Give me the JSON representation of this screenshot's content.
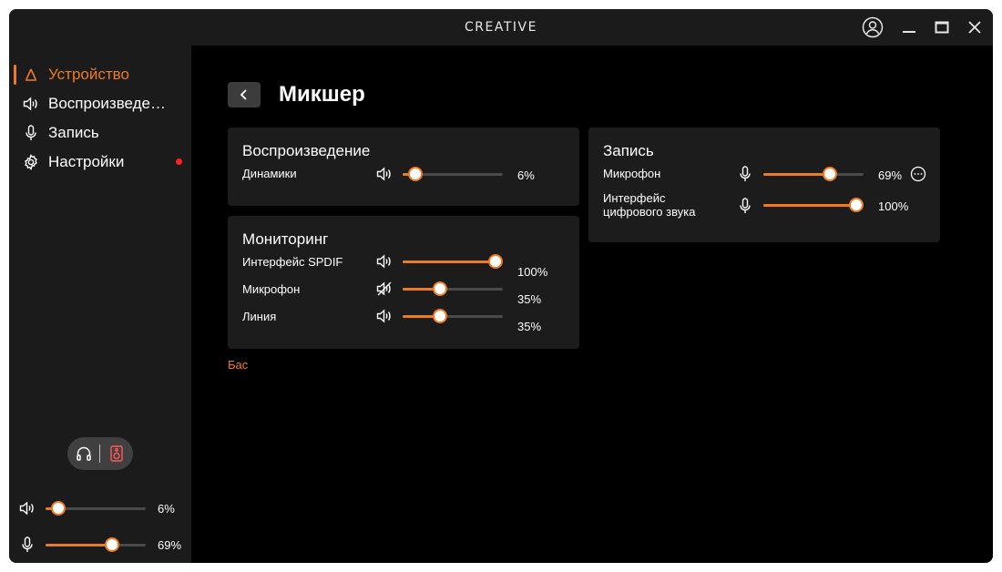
{
  "app": {
    "logo": "CREATIVE"
  },
  "window_controls": {
    "account": "user-icon",
    "minimize": "minimize-icon",
    "maximize": "maximize-icon",
    "close": "close-icon"
  },
  "sidebar": {
    "items": [
      {
        "label": "Устройство",
        "icon": "device-icon",
        "active": true
      },
      {
        "label": "Воспроизведение",
        "icon": "speaker-icon"
      },
      {
        "label": "Запись",
        "icon": "microphone-icon"
      },
      {
        "label": "Настройки",
        "icon": "gear-icon",
        "badge": "red-dot"
      }
    ],
    "output_toggle": {
      "left": "headphones-icon",
      "right": "speaker-box-icon"
    },
    "volume": {
      "icon": "speaker-icon",
      "value": 6,
      "text": "6%"
    },
    "mic": {
      "icon": "microphone-icon",
      "value": 69,
      "text": "69%"
    }
  },
  "page": {
    "title": "Микшер",
    "back_icon": "chevron-left-icon"
  },
  "playback_card": {
    "title": "Воспроизведение",
    "rows": [
      {
        "label": "Динамики",
        "icon": "speaker-icon",
        "value": 6,
        "text": "6%"
      }
    ]
  },
  "monitoring_card": {
    "title": "Мониторинг",
    "rows": [
      {
        "label": "Интерфейс SPDIF",
        "icon": "speaker-icon",
        "value": 100,
        "text": "100%"
      },
      {
        "label": "Микрофон",
        "icon": "speaker-muted-icon",
        "value": 35,
        "text": "35%"
      },
      {
        "label": "Линия",
        "icon": "speaker-icon",
        "value": 35,
        "text": "35%"
      }
    ]
  },
  "recording_card": {
    "title": "Запись",
    "rows": [
      {
        "label": "Микрофон",
        "icon": "microphone-icon",
        "value": 69,
        "text": "69%",
        "extra": "more-options-icon"
      },
      {
        "label": "Интерфейс\nцифрового звука",
        "icon": "microphone-icon",
        "value": 100,
        "text": "100%"
      }
    ]
  },
  "footer_link": "Бас",
  "colors": {
    "accent": "#f07a22",
    "card": "#1c1c1c",
    "sidebar": "#1b1b1b",
    "background": "#000000",
    "badge": "#ff2020"
  }
}
